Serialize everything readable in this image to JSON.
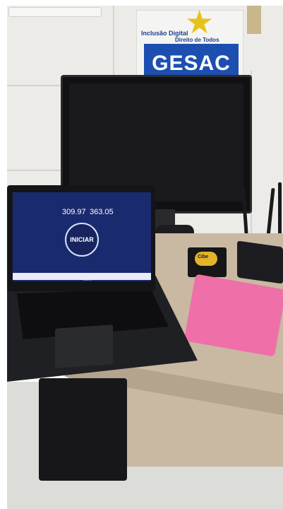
{
  "poster": {
    "line1": "Inclusão Digital",
    "line2": "Direito de Todos",
    "logo": "GESAC"
  },
  "box": {
    "label": "Cibe"
  },
  "laptop": {
    "brand": "acer",
    "speedtest": {
      "download_value": "309.97",
      "upload_value": "363.05",
      "start_button": "INICIAR"
    }
  }
}
